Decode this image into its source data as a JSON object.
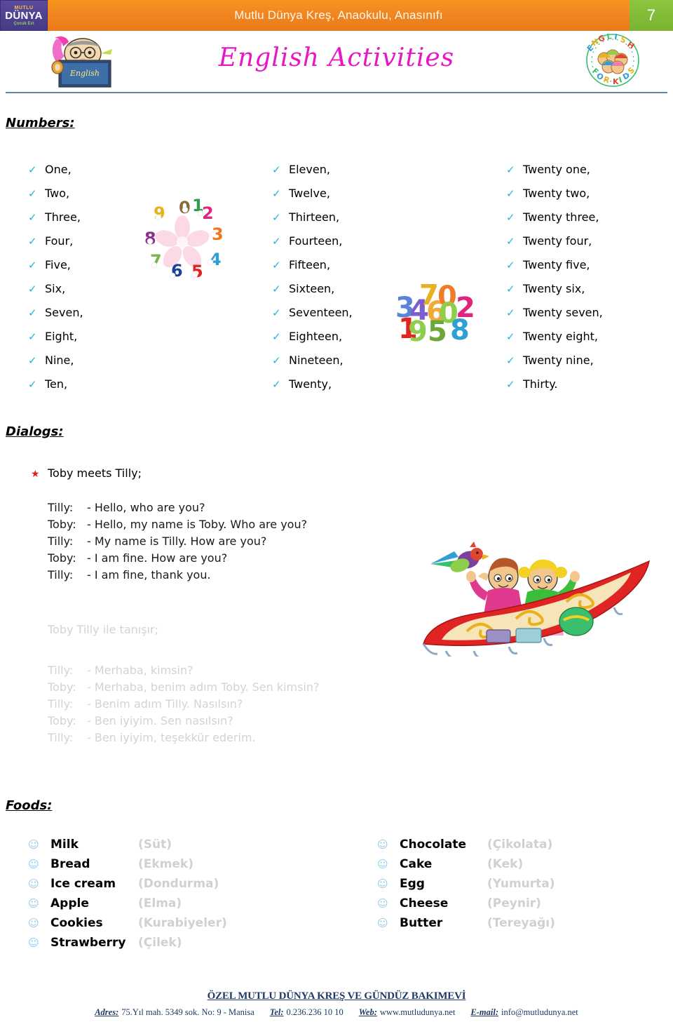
{
  "header": {
    "logo": {
      "line1": "MUTLU",
      "line2": "DÜNYA",
      "line3": "Çocuk Evi"
    },
    "title": "Mutlu Dünya Kreş, Anaokulu, Anasınıfı",
    "page_number": "7",
    "bar_color": "#f0821e",
    "page_number_bg": "#8cc63e"
  },
  "page_title": {
    "text": "English Activities",
    "color": "#e817c6"
  },
  "sections": {
    "numbers_heading": "Numbers:",
    "dialogs_heading": "Dialogs:",
    "foods_heading": "Foods:"
  },
  "numbers": {
    "column1": [
      "One,",
      "Two,",
      "Three,",
      "Four,",
      "Five,",
      "Six,",
      "Seven,",
      "Eight,",
      "Nine,",
      "Ten,"
    ],
    "column2": [
      "Eleven,",
      "Twelve,",
      "Thirteen,",
      "Fourteen,",
      "Fifteen,",
      "Sixteen,",
      "Seventeen,",
      "Eighteen,",
      "Nineteen,",
      "Twenty,"
    ],
    "column3": [
      "Twenty one,",
      "Twenty two,",
      "Twenty three,",
      "Twenty four,",
      "Twenty five,",
      "Twenty six,",
      "Twenty seven,",
      "Twenty eight,",
      "Twenty nine,",
      "Thirty."
    ],
    "bullet_glyph": "✓",
    "bullet_color": "#22b5e0"
  },
  "dialogs": {
    "star_glyph": "★",
    "star_color": "#e02020",
    "english": {
      "title": "Toby meets Tilly;",
      "lines": [
        {
          "speaker": "Tilly:",
          "text": "- Hello, who are you?"
        },
        {
          "speaker": "Toby:",
          "text": "- Hello, my name is Toby. Who are you?"
        },
        {
          "speaker": "Tilly:",
          "text": "- My name is Tilly. How are you?"
        },
        {
          "speaker": "Toby:",
          "text": "- I am fine. How are you?"
        },
        {
          "speaker": "Tilly:",
          "text": "- I am fine, thank you."
        }
      ]
    },
    "turkish": {
      "title": "Toby Tilly ile tanışır;",
      "lines": [
        {
          "speaker": "Tilly:",
          "text": "- Merhaba, kimsin?"
        },
        {
          "speaker": "Toby:",
          "text": "- Merhaba, benim adım Toby. Sen kimsin?"
        },
        {
          "speaker": "Tilly:",
          "text": "- Benim adım Tilly. Nasılsın?"
        },
        {
          "speaker": "Toby:",
          "text": "- Ben iyiyim. Sen nasılsın?"
        },
        {
          "speaker": "Tilly:",
          "text": "- Ben iyiyim, teşekkür ederim."
        }
      ]
    }
  },
  "foods": {
    "bullet_glyph": "☺",
    "bullet_color": "#8ecae6",
    "column1": [
      {
        "en": "Milk",
        "tr": "(Süt)"
      },
      {
        "en": "Bread",
        "tr": "(Ekmek)"
      },
      {
        "en": "Ice cream",
        "tr": "(Dondurma)"
      },
      {
        "en": "Apple",
        "tr": "(Elma)"
      },
      {
        "en": "Cookies",
        "tr": "(Kurabiyeler)"
      },
      {
        "en": "Strawberry",
        "tr": "(Çilek)"
      }
    ],
    "column2": [
      {
        "en": "Chocolate",
        "tr": "(Çikolata)"
      },
      {
        "en": "Cake",
        "tr": "(Kek)"
      },
      {
        "en": "Egg",
        "tr": "(Yumurta)"
      },
      {
        "en": "Cheese",
        "tr": "(Peynir)"
      },
      {
        "en": "Butter",
        "tr": "(Tereyağı)"
      }
    ]
  },
  "footer": {
    "title": "ÖZEL MUTLU DÜNYA KREŞ VE GÜNDÜZ BAKIMEVİ",
    "address_label": "Adres:",
    "address_value": "75.Yıl mah. 5349 sok. No: 9 - Manisa",
    "tel_label": "Tel:",
    "tel_value": "0.236.236 10 10",
    "web_label": "Web:",
    "web_value": "www.mutludunya.net",
    "email_label": "E-mail:",
    "email_value": "info@mutludunya.net",
    "color": "#1f3864"
  }
}
